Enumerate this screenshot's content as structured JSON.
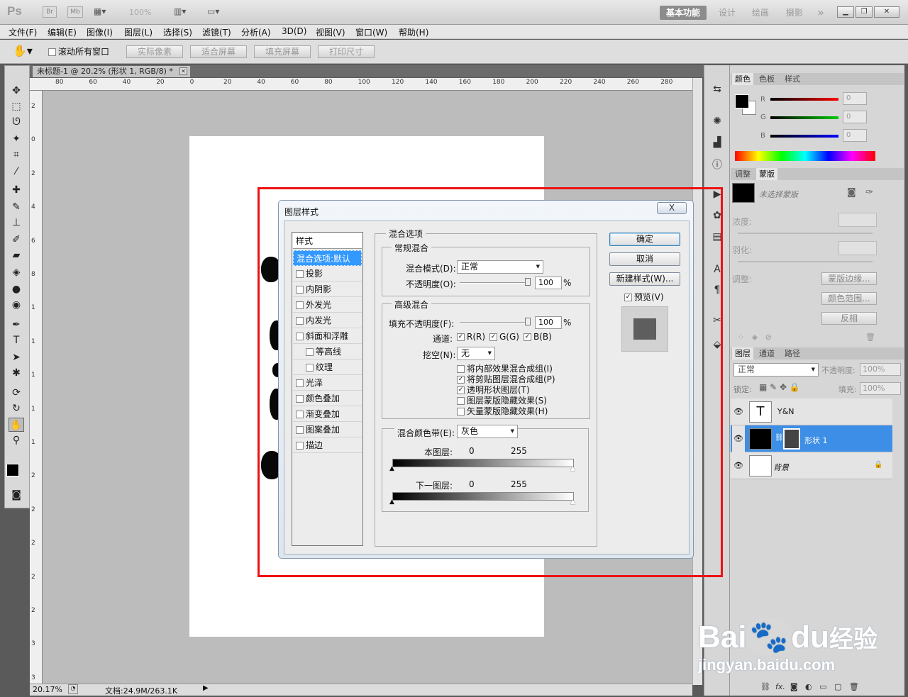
{
  "app": {
    "logo": "Ps",
    "zoom_combo": "100%",
    "mini_br": "Br",
    "mini_mb": "Mb"
  },
  "workspaces": [
    "基本功能",
    "设计",
    "绘画",
    "摄影"
  ],
  "workspace_more": "»",
  "menus": [
    "文件(F)",
    "编辑(E)",
    "图像(I)",
    "图层(L)",
    "选择(S)",
    "滤镜(T)",
    "分析(A)",
    "3D(D)",
    "视图(V)",
    "窗口(W)",
    "帮助(H)"
  ],
  "options": {
    "scroll_all": "滚动所有窗口",
    "actual_pixels": "实际像素",
    "fit_screen": "适合屏幕",
    "fill_screen": "填充屏幕",
    "print_size": "打印尺寸"
  },
  "document": {
    "tab_title": "未标题-1 @ 20.2% (形状 1, RGB/8) *",
    "zoom": "20.17%",
    "doc_info": "文档:24.9M/263.1K"
  },
  "ruler_h": [
    "80",
    "60",
    "40",
    "20",
    "0",
    "20",
    "40",
    "60",
    "80",
    "100",
    "120",
    "140",
    "160",
    "180",
    "200",
    "220",
    "240",
    "260",
    "280"
  ],
  "ruler_v": [
    "2",
    "0",
    "2",
    "4",
    "6",
    "8",
    "1",
    "1",
    "1",
    "1",
    "1",
    "2",
    "2",
    "2",
    "2",
    "2",
    "3",
    "3"
  ],
  "panel_color": {
    "tabs": [
      "颜色",
      "色板",
      "样式"
    ],
    "r_label": "R",
    "g_label": "G",
    "b_label": "B",
    "r": "0",
    "g": "0",
    "b": "0"
  },
  "panel_mask": {
    "tabs": [
      "调整",
      "蒙版"
    ],
    "no_mask": "未选择蒙版",
    "density": "浓度:",
    "feather": "羽化:",
    "adjust": "调整:",
    "btn_edge": "蒙版边缘...",
    "btn_color_range": "颜色范围...",
    "btn_invert": "反相"
  },
  "panel_layers": {
    "tabs": [
      "图层",
      "通道",
      "路径"
    ],
    "blend": "正常",
    "opacity_label": "不透明度:",
    "opacity": "100%",
    "lock_label": "锁定:",
    "fill_label": "填充:",
    "fill": "100%",
    "layers": [
      {
        "name": "Y&N",
        "thumb": "T"
      },
      {
        "name": "形状 1"
      },
      {
        "name": "背景"
      }
    ],
    "bottom_fx": "fx."
  },
  "dialog": {
    "title": "图层样式",
    "close": "X",
    "styles_header": "样式",
    "styles": [
      "混合选项:默认",
      "投影",
      "内阴影",
      "外发光",
      "内发光",
      "斜面和浮雕",
      "等高线",
      "纹理",
      "光泽",
      "颜色叠加",
      "渐变叠加",
      "图案叠加",
      "描边"
    ],
    "blend_options": "混合选项",
    "general_blend": "常规混合",
    "blend_mode_label": "混合模式(D):",
    "blend_mode": "正常",
    "opacity_label": "不透明度(O):",
    "opacity": "100",
    "percent": "%",
    "advanced_blend": "高级混合",
    "fill_opacity_label": "填充不透明度(F):",
    "fill_opacity": "100",
    "channels_label": "通道:",
    "ch_r": "R(R)",
    "ch_g": "G(G)",
    "ch_b": "B(B)",
    "knockout_label": "挖空(N):",
    "knockout": "无",
    "adv_options": [
      {
        "label": "将内部效果混合成组(I)",
        "checked": false
      },
      {
        "label": "将剪贴图层混合成组(P)",
        "checked": true
      },
      {
        "label": "透明形状图层(T)",
        "checked": true
      },
      {
        "label": "图层蒙版隐藏效果(S)",
        "checked": false
      },
      {
        "label": "矢量蒙版隐藏效果(H)",
        "checked": false
      }
    ],
    "blend_if_label": "混合颜色带(E):",
    "blend_if": "灰色",
    "this_layer": "本图层:",
    "under_layer": "下一图层:",
    "v0": "0",
    "v255": "255",
    "btn_ok": "确定",
    "btn_cancel": "取消",
    "btn_new_style": "新建样式(W)...",
    "preview_label": "预览(V)",
    "checkmark": "✓"
  },
  "watermark": {
    "brand1": "Bai",
    "brand2": "du",
    "brand3": "经验",
    "url": "jingyan.baidu.com"
  },
  "colors": {
    "accent": "#3d8ee6",
    "red_highlight": "#ee1111",
    "ps_bg": "#5a5a5a"
  }
}
